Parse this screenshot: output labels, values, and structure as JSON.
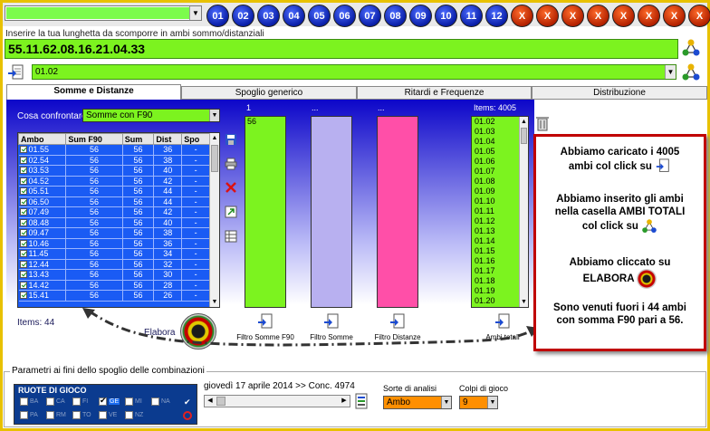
{
  "topbar": {
    "numbers": [
      "01",
      "02",
      "03",
      "04",
      "05",
      "06",
      "07",
      "08",
      "09",
      "10",
      "11",
      "12"
    ],
    "x_label": "X"
  },
  "input": {
    "label": "Inserire la tua lunghetta da scomporre in ambi sommo/distanziali",
    "value": "55.11.62.08.16.21.04.33",
    "select_value": "01.02"
  },
  "tabs": [
    "Somme e Distanze",
    "Spoglio generico",
    "Ritardi e Frequenze",
    "Distribuzione"
  ],
  "panel": {
    "confronta_label": "Cosa confrontare",
    "confronta_value": "Somme con F90",
    "columns": [
      "Ambo",
      "Sum F90",
      "Sum",
      "Dist",
      "Spo"
    ],
    "rows": [
      [
        "01.55",
        "56",
        "56",
        "36",
        "-"
      ],
      [
        "02.54",
        "56",
        "56",
        "38",
        "-"
      ],
      [
        "03.53",
        "56",
        "56",
        "40",
        "-"
      ],
      [
        "04.52",
        "56",
        "56",
        "42",
        "-"
      ],
      [
        "05.51",
        "56",
        "56",
        "44",
        "-"
      ],
      [
        "06.50",
        "56",
        "56",
        "44",
        "-"
      ],
      [
        "07.49",
        "56",
        "56",
        "42",
        "-"
      ],
      [
        "08.48",
        "56",
        "56",
        "40",
        "-"
      ],
      [
        "09.47",
        "56",
        "56",
        "38",
        "-"
      ],
      [
        "10.46",
        "56",
        "56",
        "36",
        "-"
      ],
      [
        "11.45",
        "56",
        "56",
        "34",
        "-"
      ],
      [
        "12.44",
        "56",
        "56",
        "32",
        "-"
      ],
      [
        "13.43",
        "56",
        "56",
        "30",
        "-"
      ],
      [
        "14.42",
        "56",
        "56",
        "28",
        "-"
      ],
      [
        "15.41",
        "56",
        "56",
        "26",
        "-"
      ]
    ],
    "items_count": "Items: 44",
    "elabora": "Elabora",
    "col1_label": "1",
    "col2_label": "...",
    "col3_label": "...",
    "col1_value": "56",
    "filters": [
      "Filtro Somme F90",
      "Filtro Somme",
      "Filtro Distanze",
      "Ambi totali"
    ],
    "ambi_items_label": "Items: 4005",
    "ambi_totali": [
      "01.02",
      "01.03",
      "01.04",
      "01.05",
      "01.06",
      "01.07",
      "01.08",
      "01.09",
      "01.10",
      "01.11",
      "01.12",
      "01.13",
      "01.14",
      "01.15",
      "01.16",
      "01.17",
      "01.18",
      "01.19",
      "01.20"
    ]
  },
  "callout": {
    "p1a": "Abbiamo caricato i 4005",
    "p1b": "ambi col click su",
    "p2a": "Abbiamo inserito gli ambi",
    "p2b": "nella casella AMBI TOTALI",
    "p2c": "col click su",
    "p3a": "Abbiamo cliccato su",
    "p3b": "ELABORA",
    "p4a": "Sono venuti fuori i 44 ambi",
    "p4b": "con somma F90 pari a 56."
  },
  "bottom": {
    "legend": "Parametri ai fini dello spoglio delle combinazioni",
    "ruote_label": "RUOTE DI GIOCO",
    "ruote": [
      "BA",
      "CA",
      "FI",
      "GE",
      "MI",
      "NA",
      "PA",
      "RM",
      "TO",
      "VE",
      "NZ"
    ],
    "ruota_checked": "GE",
    "date_text": "giovedì 17 aprile 2014 >> Conc. 4974",
    "sorte_label": "Sorte di analisi",
    "sorte_value": "Ambo",
    "colpi_label": "Colpi di gioco",
    "colpi_value": "9"
  }
}
